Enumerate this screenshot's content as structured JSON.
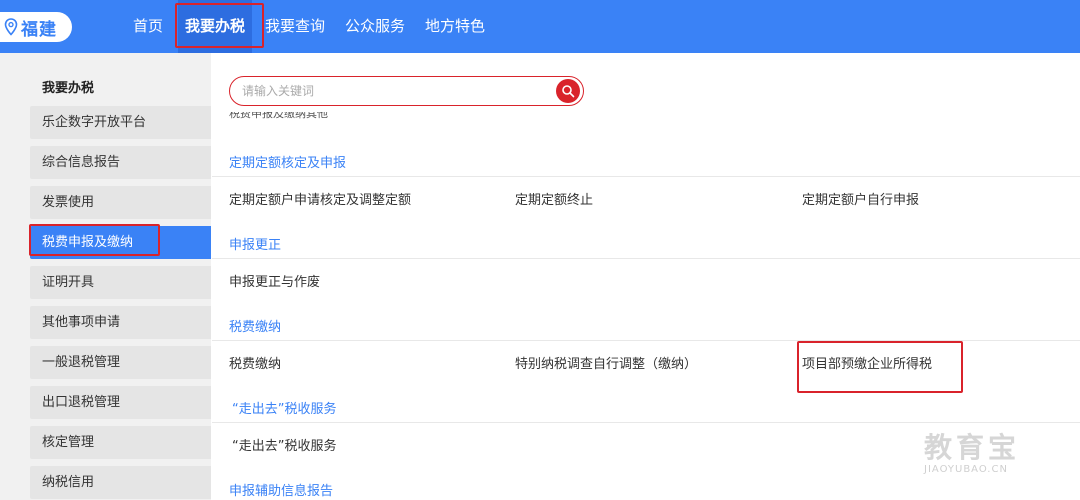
{
  "header": {
    "region": "福建",
    "nav": [
      {
        "label": "首页"
      },
      {
        "label": "我要办税"
      },
      {
        "label": "我要查询"
      },
      {
        "label": "公众服务"
      },
      {
        "label": "地方特色"
      }
    ]
  },
  "sidebar": {
    "title": "我要办税",
    "items": [
      {
        "label": "乐企数字开放平台"
      },
      {
        "label": "综合信息报告"
      },
      {
        "label": "发票使用"
      },
      {
        "label": "税费申报及缴纳"
      },
      {
        "label": "证明开具"
      },
      {
        "label": "其他事项申请"
      },
      {
        "label": "一般退税管理"
      },
      {
        "label": "出口退税管理"
      },
      {
        "label": "核定管理"
      },
      {
        "label": "纳税信用"
      }
    ]
  },
  "search": {
    "placeholder": "请输入关键词",
    "value": ""
  },
  "main": {
    "cut_text": "税费申报及缴纳其他",
    "sections": [
      {
        "title": "定期定额核定及申报",
        "links": [
          "定期定额户申请核定及调整定额",
          "定期定额终止",
          "定期定额户自行申报"
        ]
      },
      {
        "title": "申报更正",
        "links": [
          "申报更正与作废"
        ]
      },
      {
        "title": "税费缴纳",
        "links": [
          "税费缴纳",
          "特别纳税调查自行调整（缴纳）",
          "项目部预缴企业所得税"
        ]
      },
      {
        "title": "“走出去”税收服务",
        "links": [
          "“走出去”税收服务"
        ]
      },
      {
        "title": "申报辅助信息报告",
        "links": []
      }
    ]
  },
  "watermark": {
    "big": "教育宝",
    "small": "JIAOYUBAO.CN"
  },
  "colors": {
    "brand_blue": "#3a82f6",
    "highlight_red": "#d9232b",
    "sidebar_bg": "#f1f1f1"
  }
}
